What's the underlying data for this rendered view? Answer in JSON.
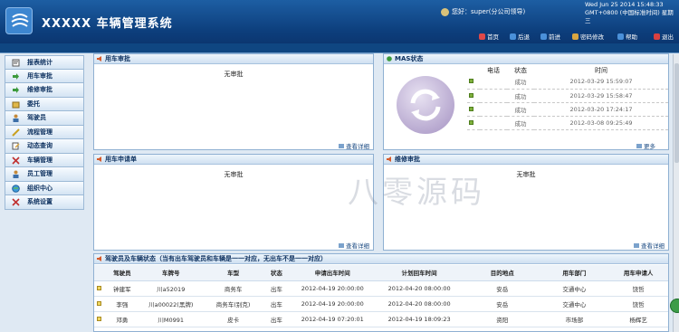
{
  "header": {
    "title": "XXXXX 车辆管理系统",
    "user": "您好：super(分公司领导)",
    "clock_line1": "Wed Jun 25 2014 15:48:33",
    "clock_line2": "GMT+0800 (中国标准时间) 星期三",
    "nav": [
      {
        "label": "首页",
        "color": "#e04848"
      },
      {
        "label": "后退",
        "color": "#4a90d9"
      },
      {
        "label": "前进",
        "color": "#4a90d9"
      },
      {
        "label": "密码修改",
        "color": "#d9a640"
      },
      {
        "label": "帮助",
        "color": "#4a90d9"
      },
      {
        "label": "退出",
        "color": "#d94040"
      }
    ]
  },
  "sidebar": {
    "items": [
      {
        "label": "报表统计",
        "icon": "report-icon"
      },
      {
        "label": "用车审批",
        "icon": "arrow-right-icon"
      },
      {
        "label": "维修审批",
        "icon": "arrow-right-icon"
      },
      {
        "label": "委托",
        "icon": "folder-icon"
      },
      {
        "label": "驾驶员",
        "icon": "person-icon"
      },
      {
        "label": "流程管理",
        "icon": "process-icon"
      },
      {
        "label": "动态查询",
        "icon": "edit-icon"
      },
      {
        "label": "车辆管理",
        "icon": "tools-icon"
      },
      {
        "label": "员工管理",
        "icon": "person-icon"
      },
      {
        "label": "组织中心",
        "icon": "globe-icon"
      },
      {
        "label": "系统设置",
        "icon": "tools-icon"
      }
    ]
  },
  "panels": {
    "vehicle_approval": {
      "title": "用车审批",
      "empty": "无审批",
      "more": "查看详细"
    },
    "mas_status": {
      "title": "MAS状态",
      "more": "更多",
      "columns": [
        "电话",
        "状态",
        "时间"
      ],
      "rows": [
        {
          "phone": "",
          "status": "成功",
          "time": "2012-03-29 15:59:07"
        },
        {
          "phone": "",
          "status": "成功",
          "time": "2012-03-29 15:58:47"
        },
        {
          "phone": "",
          "status": "成功",
          "time": "2012-03-20 17:24:17"
        },
        {
          "phone": "",
          "status": "成功",
          "time": "2012-03-08 09:25:49"
        }
      ]
    },
    "vehicle_request": {
      "title": "用车申请单",
      "empty": "无审批",
      "more": "查看详细"
    },
    "repair_approval": {
      "title": "维修审批",
      "empty": "无审批",
      "more": "查看详细"
    },
    "driver_status": {
      "title": "驾驶员及车辆状态（当有出车驾驶员和车辆是一一对应，无出车不是一一对应）",
      "columns": [
        "驾驶员",
        "车牌号",
        "车型",
        "状态",
        "申请出车时间",
        "计划回车时间",
        "目的地点",
        "用车部门",
        "用车申请人"
      ],
      "rows": [
        [
          "钟建军",
          "川a52019",
          "商务车",
          "出车",
          "2012-04-19 20:00:00",
          "2012-04-20 08:00:00",
          "安岳",
          "交通中心",
          "饶哲"
        ],
        [
          "李强",
          "川a00022(黑牌)",
          "商务车(别克)",
          "出车",
          "2012-04-19 20:00:00",
          "2012-04-20 08:00:00",
          "安岳",
          "交通中心",
          "饶哲"
        ],
        [
          "邓勇",
          "川M0991",
          "皮卡",
          "出车",
          "2012-04-19 07:20:01",
          "2012-04-19 18:09:23",
          "资阳",
          "市场部",
          "杨辉艺"
        ]
      ]
    }
  },
  "watermark": "八零源码"
}
